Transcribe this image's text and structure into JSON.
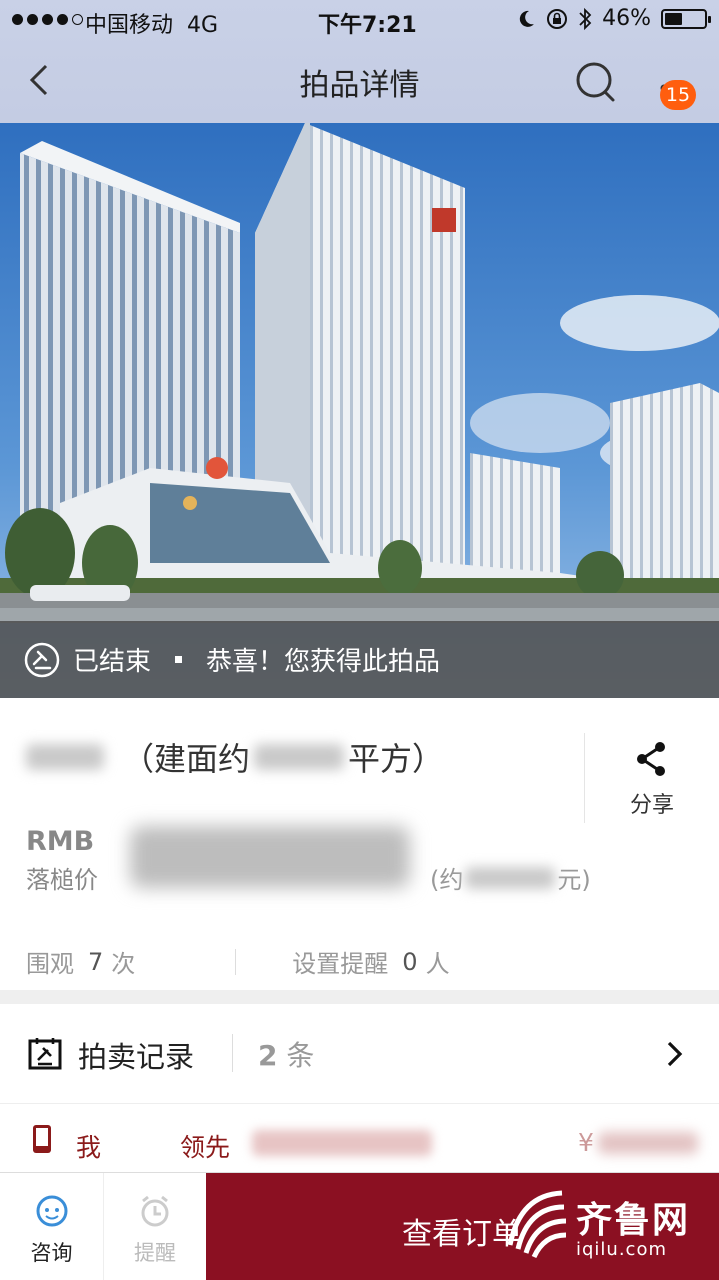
{
  "status_bar": {
    "carrier": "中国移动",
    "network": "4G",
    "time": "下午7:21",
    "battery_percent": "46%",
    "battery_level": 0.46
  },
  "nav": {
    "title": "拍品详情",
    "badge_count": "15",
    "icons": [
      "back-icon",
      "search-icon",
      "more-icon"
    ]
  },
  "auction_status": {
    "state": "已结束",
    "message": "恭喜！您获得此拍品"
  },
  "lot": {
    "title": "（建面约",
    "title_end": "平方）",
    "share_label": "分享"
  },
  "price": {
    "currency": "RMB",
    "label": "落槌价",
    "approx_prefix": "(约",
    "approx_suffix": "元)"
  },
  "stats": {
    "views_label": "围观",
    "views_count": "7",
    "views_unit": "次",
    "reminders_label": "设置提醒",
    "reminders_count": "0",
    "reminders_unit": "人"
  },
  "records": {
    "label": "拍卖记录",
    "count": "2",
    "unit": "条"
  },
  "bid_row": {
    "bidder": "我",
    "status": "领先",
    "currency_symbol": "¥"
  },
  "toolbar": {
    "consult_label": "咨询",
    "remind_label": "提醒",
    "order_button": "查看订单"
  },
  "watermark": {
    "name": "齐鲁网",
    "url": "iqilu.com"
  },
  "colors": {
    "brand_red": "#8b1022",
    "badge_orange": "#ff5e0e",
    "nav_bg": "#c9d1e7"
  }
}
